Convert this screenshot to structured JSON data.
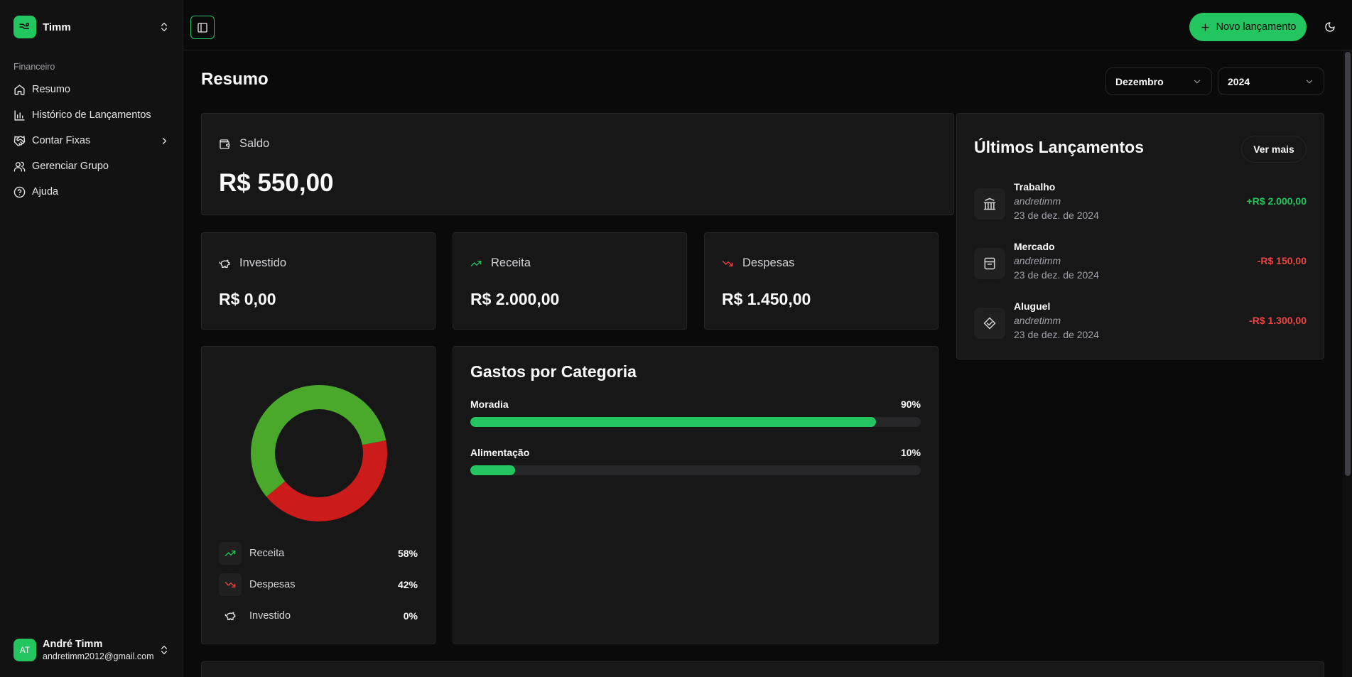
{
  "sidebar": {
    "team_name": "Timm",
    "group_label": "Financeiro",
    "items": [
      {
        "label": "Resumo"
      },
      {
        "label": "Histórico de Lançamentos"
      },
      {
        "label": "Contar Fixas"
      },
      {
        "label": "Gerenciar Grupo"
      },
      {
        "label": "Ajuda"
      }
    ],
    "user": {
      "initials": "AT",
      "name": "André Timm",
      "email": "andretimm2012@gmail.com"
    }
  },
  "header": {
    "new_button_label": "Novo lançamento"
  },
  "main": {
    "title": "Resumo",
    "month_select": "Dezembro",
    "year_select": "2024",
    "balance": {
      "label": "Saldo",
      "value": "R$ 550,00"
    },
    "stats": [
      {
        "label": "Investido",
        "value": "R$ 0,00",
        "icon": "piggy-bank-icon"
      },
      {
        "label": "Receita",
        "value": "R$ 2.000,00",
        "icon": "trending-up-icon"
      },
      {
        "label": "Despesas",
        "value": "R$ 1.450,00",
        "icon": "trending-down-icon"
      }
    ],
    "donut": {
      "legend": [
        {
          "label": "Receita",
          "pct": "58%"
        },
        {
          "label": "Despesas",
          "pct": "42%"
        },
        {
          "label": "Investido",
          "pct": "0%"
        }
      ],
      "slices": [
        {
          "name": "Receita",
          "fraction": 0.58,
          "color": "#4aa82a"
        },
        {
          "name": "Despesas",
          "fraction": 0.42,
          "color": "#cc1b1b"
        },
        {
          "name": "Investido",
          "fraction": 0.0,
          "color": "#ffffff"
        }
      ]
    },
    "categories": {
      "title": "Gastos por Categoria",
      "items": [
        {
          "label": "Moradia",
          "pct_label": "90%",
          "fraction": 0.9
        },
        {
          "label": "Alimentação",
          "pct_label": "10%",
          "fraction": 0.1
        }
      ]
    },
    "recent": {
      "title": "Últimos Lançamentos",
      "more_label": "Ver mais",
      "items": [
        {
          "name": "Trabalho",
          "user": "andretimm",
          "date": "23 de dez. de 2024",
          "amount": "+R$ 2.000,00",
          "color": "#22c55e",
          "icon": "bank-icon"
        },
        {
          "name": "Mercado",
          "user": "andretimm",
          "date": "23 de dez. de 2024",
          "amount": "-R$ 150,00",
          "color": "#ef4444",
          "icon": "store-icon"
        },
        {
          "name": "Aluguel",
          "user": "andretimm",
          "date": "23 de dez. de 2024",
          "amount": "-R$ 1.300,00",
          "color": "#ef4444",
          "icon": "handshake-icon"
        }
      ]
    }
  },
  "colors": {
    "accent": "#22c55e",
    "income": "#22c55e",
    "expense": "#ef4444"
  }
}
